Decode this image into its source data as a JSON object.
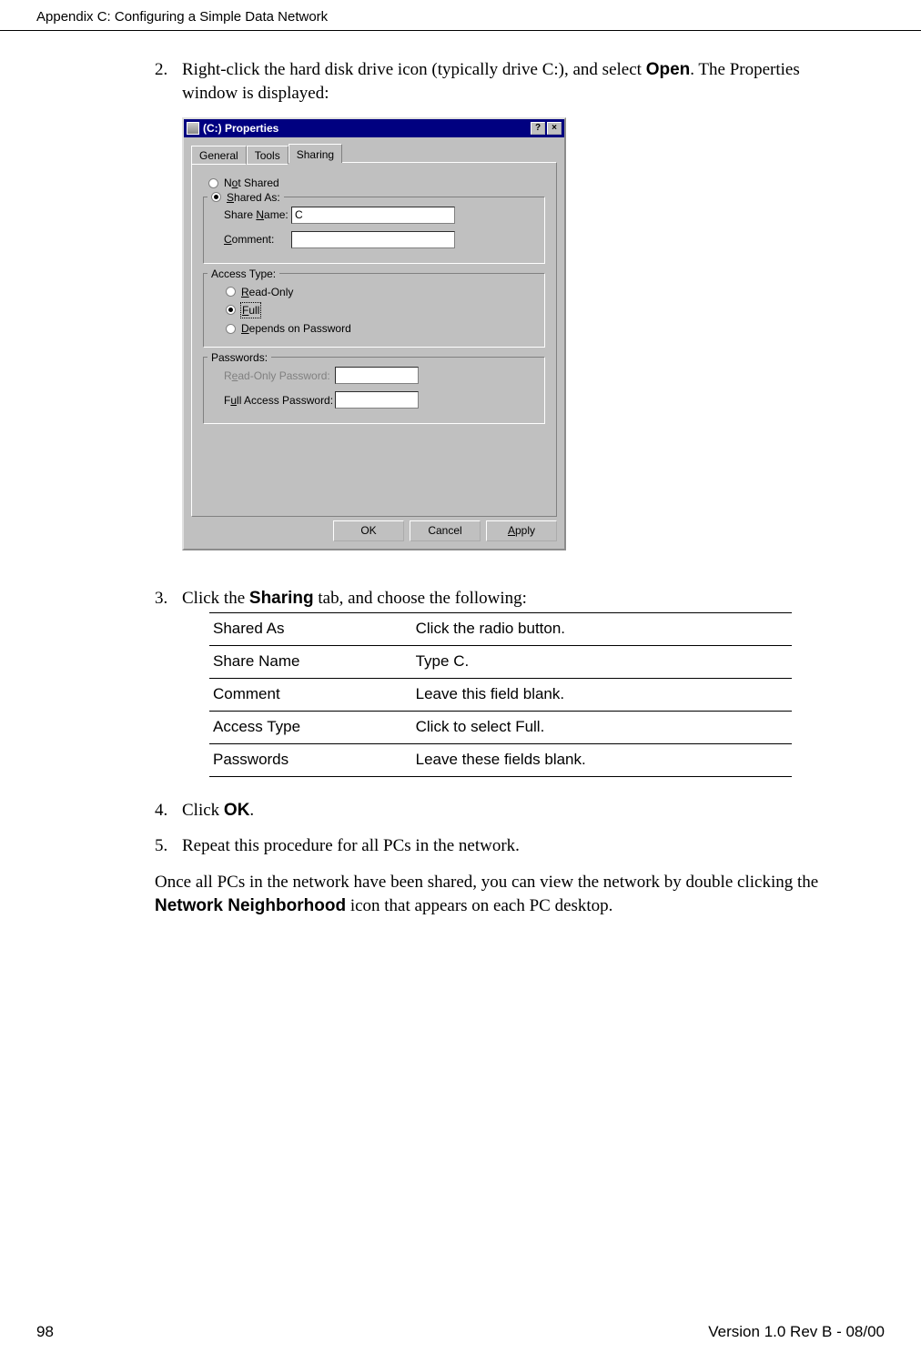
{
  "header": {
    "title": "Appendix C: Configuring a Simple Data Network"
  },
  "steps": {
    "s2_num": "2.",
    "s2_a": "Right-click the hard disk drive icon (typically drive C:), and select ",
    "s2_b_bold": "Open",
    "s2_c": ". The Properties window is displayed:",
    "s3_num": "3.",
    "s3_a": "Click the ",
    "s3_b_bold": "Sharing",
    "s3_c": " tab, and choose the following:",
    "s4_num": "4.",
    "s4_a": "Click ",
    "s4_b_bold": "OK",
    "s4_c": ".",
    "s5_num": "5.",
    "s5_a": "Repeat this procedure for all PCs in the network.",
    "closing_a": "Once all PCs in the network have been shared, you can view the network by double clicking the ",
    "closing_b_bold": "Network Neighborhood",
    "closing_c": " icon that appears on each PC desktop."
  },
  "dialog": {
    "title": "(C:) Properties",
    "help": "?",
    "close": "×",
    "tabs": {
      "general": "General",
      "tools": "Tools",
      "sharing": "Sharing"
    },
    "not_shared": "Not Shared",
    "shared_as": "Shared As:",
    "share_name_label": "Share Name:",
    "share_name_value": "C",
    "comment_label": "Comment:",
    "comment_value": "",
    "access_type_legend": "Access Type:",
    "read_only": "Read-Only",
    "full": "Full",
    "depends": "Depends on Password",
    "passwords_legend": "Passwords:",
    "ro_pw_label": "Read-Only Password:",
    "full_pw_label": "Full Access Password:",
    "ok": "OK",
    "cancel": "Cancel",
    "apply": "Apply"
  },
  "table": {
    "r1a": "Shared As",
    "r1b": "Click the radio button.",
    "r2a": "Share Name",
    "r2b": "Type C.",
    "r3a": "Comment",
    "r3b": "Leave this field blank.",
    "r4a": "Access Type",
    "r4b": "Click to select Full.",
    "r5a": "Passwords",
    "r5b": "Leave these fields blank."
  },
  "footer": {
    "page": "98",
    "version": "Version 1.0 Rev B - 08/00"
  }
}
